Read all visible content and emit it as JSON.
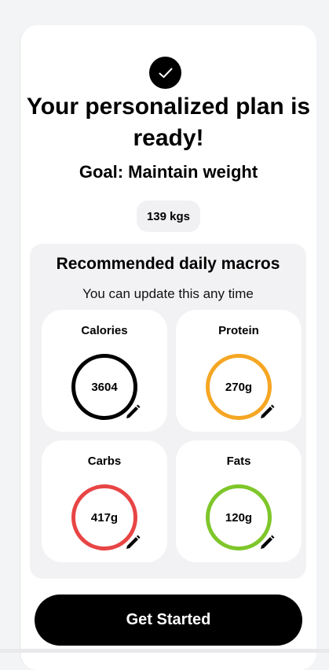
{
  "header": {
    "check_icon": "check-icon",
    "title": "Your personalized plan is ready!",
    "goal": "Goal: Maintain weight",
    "weight": "139 kgs"
  },
  "macros": {
    "heading": "Recommended daily macros",
    "subtitle": "You can update this any time",
    "cards": [
      {
        "label": "Calories",
        "value": "3604",
        "color": "#000000",
        "icon": "pencil-icon"
      },
      {
        "label": "Protein",
        "value": "270g",
        "color": "#f5a623",
        "icon": "pencil-icon"
      },
      {
        "label": "Carbs",
        "value": "417g",
        "color": "#e84545",
        "icon": "pencil-icon"
      },
      {
        "label": "Fats",
        "value": "120g",
        "color": "#7ec62a",
        "icon": "pencil-icon"
      }
    ]
  },
  "footer": {
    "cta_label": "Get Started"
  }
}
